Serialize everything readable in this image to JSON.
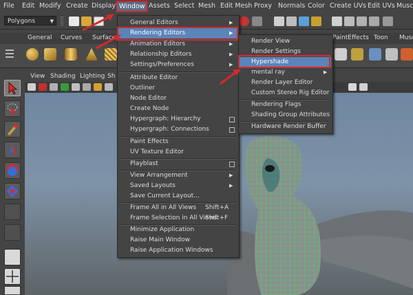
{
  "menubar": {
    "items": [
      "File",
      "Edit",
      "Modify",
      "Create",
      "Display",
      "Window",
      "Assets",
      "Select",
      "Mesh",
      "Edit Mesh",
      "Proxy",
      "Normals",
      "Color",
      "Create UVs",
      "Edit UVs",
      "Muscle"
    ],
    "active": "Window"
  },
  "statusline": {
    "mode": "Polygons"
  },
  "shelf": {
    "tabs": [
      "General",
      "Curves",
      "Surfaces",
      "PaintEffects",
      "Toon",
      "Musc"
    ]
  },
  "panel": {
    "menus": [
      "View",
      "Shading",
      "Lighting",
      "Sh"
    ]
  },
  "window_menu": {
    "items": [
      {
        "label": "General Editors",
        "submenu": true
      },
      {
        "label": "Rendering Editors",
        "submenu": true,
        "highlighted": true
      },
      {
        "label": "Animation Editors",
        "submenu": true
      },
      {
        "label": "Relationship Editors",
        "submenu": true
      },
      {
        "label": "Settings/Preferences",
        "submenu": true
      },
      {
        "label": "Attribute Editor"
      },
      {
        "label": "Outliner"
      },
      {
        "label": "Node Editor"
      },
      {
        "label": "Create Node"
      },
      {
        "label": "Hypergraph: Hierarchy",
        "option": true
      },
      {
        "label": "Hypergraph: Connections",
        "option": true
      },
      {
        "label": "Paint Effects"
      },
      {
        "label": "UV Texture Editor"
      },
      {
        "label": "Playblast",
        "option": true
      },
      {
        "label": "View Arrangement",
        "submenu": true
      },
      {
        "label": "Saved Layouts",
        "submenu": true
      },
      {
        "label": "Save Current Layout..."
      },
      {
        "label": "Frame All in All Views",
        "shortcut": "Shift+A"
      },
      {
        "label": "Frame Selection in All Views",
        "shortcut": "Shift+F"
      },
      {
        "label": "Minimize Application"
      },
      {
        "label": "Raise Main Window"
      },
      {
        "label": "Raise Application Windows"
      }
    ]
  },
  "rendering_menu": {
    "items": [
      {
        "label": "Render View"
      },
      {
        "label": "Render Settings"
      },
      {
        "label": "Hypershade",
        "highlighted": true
      },
      {
        "label": "mental ray",
        "submenu": true
      },
      {
        "label": "Render Layer Editor"
      },
      {
        "label": "Custom Stereo Rig Editor"
      },
      {
        "label": "Rendering Flags"
      },
      {
        "label": "Shading Group Attributes"
      },
      {
        "label": "Hardware Render Buffer"
      }
    ]
  },
  "colors": {
    "highlight": "#5b84b8",
    "annotation": "#d42a2e",
    "mesh_wire": "#39e64a"
  }
}
